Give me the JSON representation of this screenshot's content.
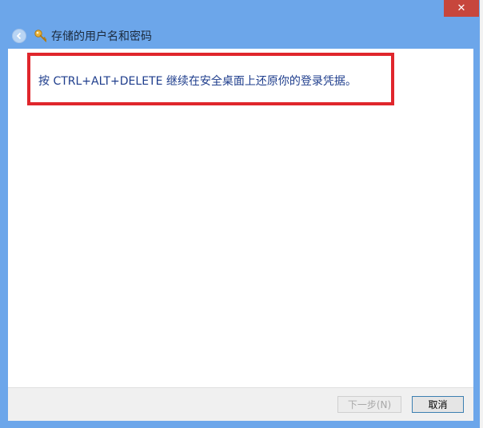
{
  "window": {
    "title": "存储的用户名和密码",
    "close_glyph": "✕"
  },
  "content": {
    "instruction": "按 CTRL+ALT+DELETE 继续在安全桌面上还原你的登录凭据。"
  },
  "footer": {
    "next_label": "下一步(N)",
    "cancel_label": "取消"
  },
  "icons": {
    "back": "back-arrow-icon",
    "key": "key-icon",
    "close": "close-icon"
  },
  "colors": {
    "frame": "#6ca6ea",
    "close": "#c7463c",
    "highlight": "#e0262c",
    "instruction_text": "#1e3d8c"
  }
}
